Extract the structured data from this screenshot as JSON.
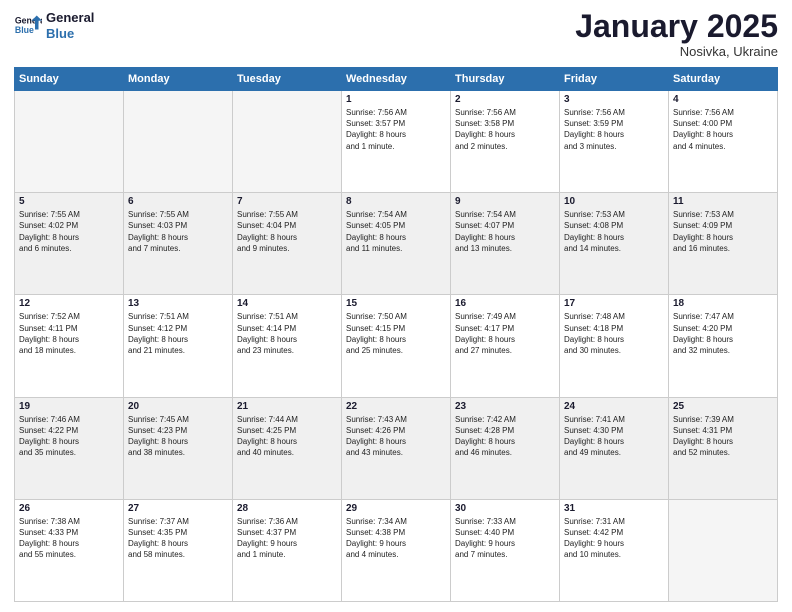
{
  "header": {
    "logo_line1": "General",
    "logo_line2": "Blue",
    "month": "January 2025",
    "location": "Nosivka, Ukraine"
  },
  "days_of_week": [
    "Sunday",
    "Monday",
    "Tuesday",
    "Wednesday",
    "Thursday",
    "Friday",
    "Saturday"
  ],
  "weeks": [
    [
      {
        "day": "",
        "info": ""
      },
      {
        "day": "",
        "info": ""
      },
      {
        "day": "",
        "info": ""
      },
      {
        "day": "1",
        "info": "Sunrise: 7:56 AM\nSunset: 3:57 PM\nDaylight: 8 hours\nand 1 minute."
      },
      {
        "day": "2",
        "info": "Sunrise: 7:56 AM\nSunset: 3:58 PM\nDaylight: 8 hours\nand 2 minutes."
      },
      {
        "day": "3",
        "info": "Sunrise: 7:56 AM\nSunset: 3:59 PM\nDaylight: 8 hours\nand 3 minutes."
      },
      {
        "day": "4",
        "info": "Sunrise: 7:56 AM\nSunset: 4:00 PM\nDaylight: 8 hours\nand 4 minutes."
      }
    ],
    [
      {
        "day": "5",
        "info": "Sunrise: 7:55 AM\nSunset: 4:02 PM\nDaylight: 8 hours\nand 6 minutes."
      },
      {
        "day": "6",
        "info": "Sunrise: 7:55 AM\nSunset: 4:03 PM\nDaylight: 8 hours\nand 7 minutes."
      },
      {
        "day": "7",
        "info": "Sunrise: 7:55 AM\nSunset: 4:04 PM\nDaylight: 8 hours\nand 9 minutes."
      },
      {
        "day": "8",
        "info": "Sunrise: 7:54 AM\nSunset: 4:05 PM\nDaylight: 8 hours\nand 11 minutes."
      },
      {
        "day": "9",
        "info": "Sunrise: 7:54 AM\nSunset: 4:07 PM\nDaylight: 8 hours\nand 13 minutes."
      },
      {
        "day": "10",
        "info": "Sunrise: 7:53 AM\nSunset: 4:08 PM\nDaylight: 8 hours\nand 14 minutes."
      },
      {
        "day": "11",
        "info": "Sunrise: 7:53 AM\nSunset: 4:09 PM\nDaylight: 8 hours\nand 16 minutes."
      }
    ],
    [
      {
        "day": "12",
        "info": "Sunrise: 7:52 AM\nSunset: 4:11 PM\nDaylight: 8 hours\nand 18 minutes."
      },
      {
        "day": "13",
        "info": "Sunrise: 7:51 AM\nSunset: 4:12 PM\nDaylight: 8 hours\nand 21 minutes."
      },
      {
        "day": "14",
        "info": "Sunrise: 7:51 AM\nSunset: 4:14 PM\nDaylight: 8 hours\nand 23 minutes."
      },
      {
        "day": "15",
        "info": "Sunrise: 7:50 AM\nSunset: 4:15 PM\nDaylight: 8 hours\nand 25 minutes."
      },
      {
        "day": "16",
        "info": "Sunrise: 7:49 AM\nSunset: 4:17 PM\nDaylight: 8 hours\nand 27 minutes."
      },
      {
        "day": "17",
        "info": "Sunrise: 7:48 AM\nSunset: 4:18 PM\nDaylight: 8 hours\nand 30 minutes."
      },
      {
        "day": "18",
        "info": "Sunrise: 7:47 AM\nSunset: 4:20 PM\nDaylight: 8 hours\nand 32 minutes."
      }
    ],
    [
      {
        "day": "19",
        "info": "Sunrise: 7:46 AM\nSunset: 4:22 PM\nDaylight: 8 hours\nand 35 minutes."
      },
      {
        "day": "20",
        "info": "Sunrise: 7:45 AM\nSunset: 4:23 PM\nDaylight: 8 hours\nand 38 minutes."
      },
      {
        "day": "21",
        "info": "Sunrise: 7:44 AM\nSunset: 4:25 PM\nDaylight: 8 hours\nand 40 minutes."
      },
      {
        "day": "22",
        "info": "Sunrise: 7:43 AM\nSunset: 4:26 PM\nDaylight: 8 hours\nand 43 minutes."
      },
      {
        "day": "23",
        "info": "Sunrise: 7:42 AM\nSunset: 4:28 PM\nDaylight: 8 hours\nand 46 minutes."
      },
      {
        "day": "24",
        "info": "Sunrise: 7:41 AM\nSunset: 4:30 PM\nDaylight: 8 hours\nand 49 minutes."
      },
      {
        "day": "25",
        "info": "Sunrise: 7:39 AM\nSunset: 4:31 PM\nDaylight: 8 hours\nand 52 minutes."
      }
    ],
    [
      {
        "day": "26",
        "info": "Sunrise: 7:38 AM\nSunset: 4:33 PM\nDaylight: 8 hours\nand 55 minutes."
      },
      {
        "day": "27",
        "info": "Sunrise: 7:37 AM\nSunset: 4:35 PM\nDaylight: 8 hours\nand 58 minutes."
      },
      {
        "day": "28",
        "info": "Sunrise: 7:36 AM\nSunset: 4:37 PM\nDaylight: 9 hours\nand 1 minute."
      },
      {
        "day": "29",
        "info": "Sunrise: 7:34 AM\nSunset: 4:38 PM\nDaylight: 9 hours\nand 4 minutes."
      },
      {
        "day": "30",
        "info": "Sunrise: 7:33 AM\nSunset: 4:40 PM\nDaylight: 9 hours\nand 7 minutes."
      },
      {
        "day": "31",
        "info": "Sunrise: 7:31 AM\nSunset: 4:42 PM\nDaylight: 9 hours\nand 10 minutes."
      },
      {
        "day": "",
        "info": ""
      }
    ]
  ]
}
